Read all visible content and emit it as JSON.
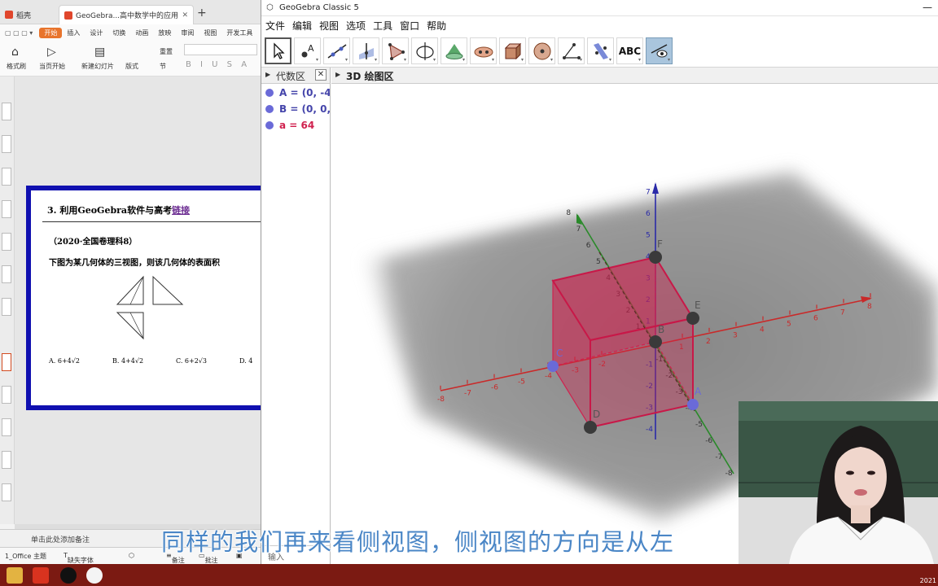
{
  "wps": {
    "tabs": [
      "稻壳",
      "GeoGebra...高中数学中的应用"
    ],
    "menu": [
      "开始",
      "插入",
      "设计",
      "切换",
      "动画",
      "放映",
      "审阅",
      "视图",
      "开发工具"
    ],
    "ribbon": {
      "format_painter": "格式刷",
      "from_current": "当页开始",
      "new_slide": "新建幻灯片",
      "layout": "版式",
      "section": "节",
      "reset": "重置"
    },
    "slide": {
      "number": "3.",
      "heading": "利用GeoGebra软件与高考",
      "heading_link": "链接",
      "source": "（2020·全国卷理科8）",
      "question": "下图为某几何体的三视图，则该几何体的表面积",
      "options": [
        "A. 6+4√2",
        "B. 4+4√2",
        "C. 6+2√3",
        "D. 4"
      ]
    },
    "note": "单击此处添加备注",
    "status": {
      "theme": "1_Office 主题",
      "missing_font": "缺失字体",
      "notes": "备注",
      "comments": "批注"
    }
  },
  "geogebra": {
    "title": "GeoGebra Classic 5",
    "menu": [
      "文件",
      "编辑",
      "视图",
      "选项",
      "工具",
      "窗口",
      "帮助"
    ],
    "tool_abc": "ABC",
    "algebra_header": "代数区",
    "graphics3d_header": "3D 绘图区",
    "algebra_items": [
      {
        "text": "A = (0, -4,",
        "color": "#6a6ad8"
      },
      {
        "text": "B = (0, 0,",
        "color": "#6a6ad8"
      },
      {
        "text": "a = 64",
        "color": "#d0224f"
      }
    ],
    "input_label": "输入",
    "scene": {
      "point_labels": {
        "A": "A",
        "B": "B",
        "C": "C",
        "D": "D",
        "E": "E",
        "F": "F"
      },
      "x_ticks": [
        "-8",
        "-7",
        "-6",
        "-5",
        "-4",
        "-3",
        "-2",
        "1",
        "2",
        "3",
        "4",
        "5",
        "6",
        "7",
        "8"
      ],
      "z_ticks": [
        "7",
        "6",
        "5",
        "4",
        "3",
        "2",
        "1",
        "-1",
        "-2",
        "-3",
        "-4"
      ],
      "y_ticks": [
        "8",
        "7",
        "6",
        "5",
        "4",
        "3",
        "2",
        "1",
        "-1",
        "-2",
        "-3",
        "-4",
        "-5",
        "-6",
        "-7",
        "-8"
      ],
      "cube_color": "#d0224f",
      "x_axis_color": "#c92a2a",
      "y_axis_color": "#2a8a2a",
      "z_axis_color": "#2a2aa8"
    }
  },
  "subtitle": "同样的我们再来看侧视图，侧视图的方向是从左",
  "taskbar": {
    "time": "2021"
  }
}
